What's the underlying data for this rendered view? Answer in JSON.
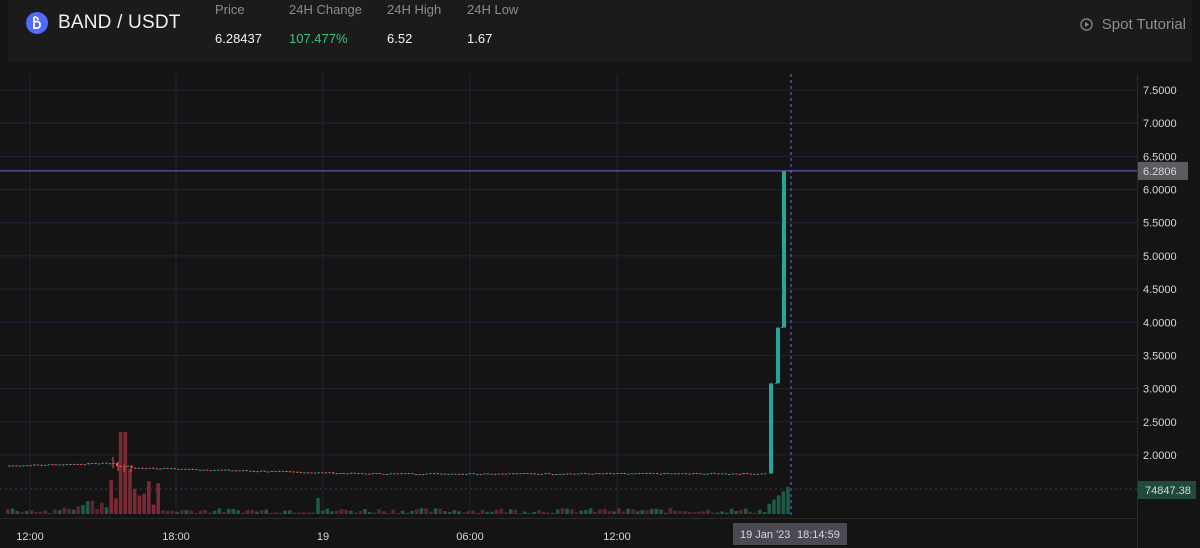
{
  "header": {
    "pair": "BAND / USDT",
    "icon": "band-protocol-logo-icon",
    "stats": [
      {
        "label": "Price",
        "value": "6.28437",
        "color": "#f2f2f2"
      },
      {
        "label": "24H Change",
        "value": "107.477%",
        "color": "#3ec27c"
      },
      {
        "label": "24H High",
        "value": "6.52",
        "color": "#f2f2f2"
      },
      {
        "label": "24H Low",
        "value": "1.67",
        "color": "#f2f2f2"
      }
    ],
    "tutorial": {
      "label": "Spot Tutorial",
      "icon": "play-circle-icon"
    }
  },
  "chart_data": {
    "type": "candlestick",
    "price_axis": {
      "ticks": [
        "7.5000",
        "7.0000",
        "6.5000",
        "6.0000",
        "5.5000",
        "5.0000",
        "4.5000",
        "4.0000",
        "3.5000",
        "3.0000",
        "2.5000",
        "2.0000"
      ],
      "range": [
        1.55,
        7.7
      ]
    },
    "time_axis": {
      "ticks": [
        "12:00",
        "18:00",
        "19",
        "06:00",
        "12:00"
      ]
    },
    "crosshair": {
      "price": "6.2806",
      "volume": "74847.38",
      "date": "19 Jan '23",
      "time": "18:14:59"
    },
    "colors": {
      "up": "#26a69a",
      "down": "#ef5350",
      "crosshair": "#6c6ccf",
      "grid": "#22223a"
    },
    "spike_candles": [
      {
        "open": 1.72,
        "close": 3.08
      },
      {
        "open": 3.08,
        "close": 3.92
      },
      {
        "open": 3.92,
        "close": 6.28
      }
    ],
    "flat_segment": {
      "start": 1.84,
      "peak": 1.88,
      "spike_high": 1.97,
      "end": 1.72
    }
  }
}
